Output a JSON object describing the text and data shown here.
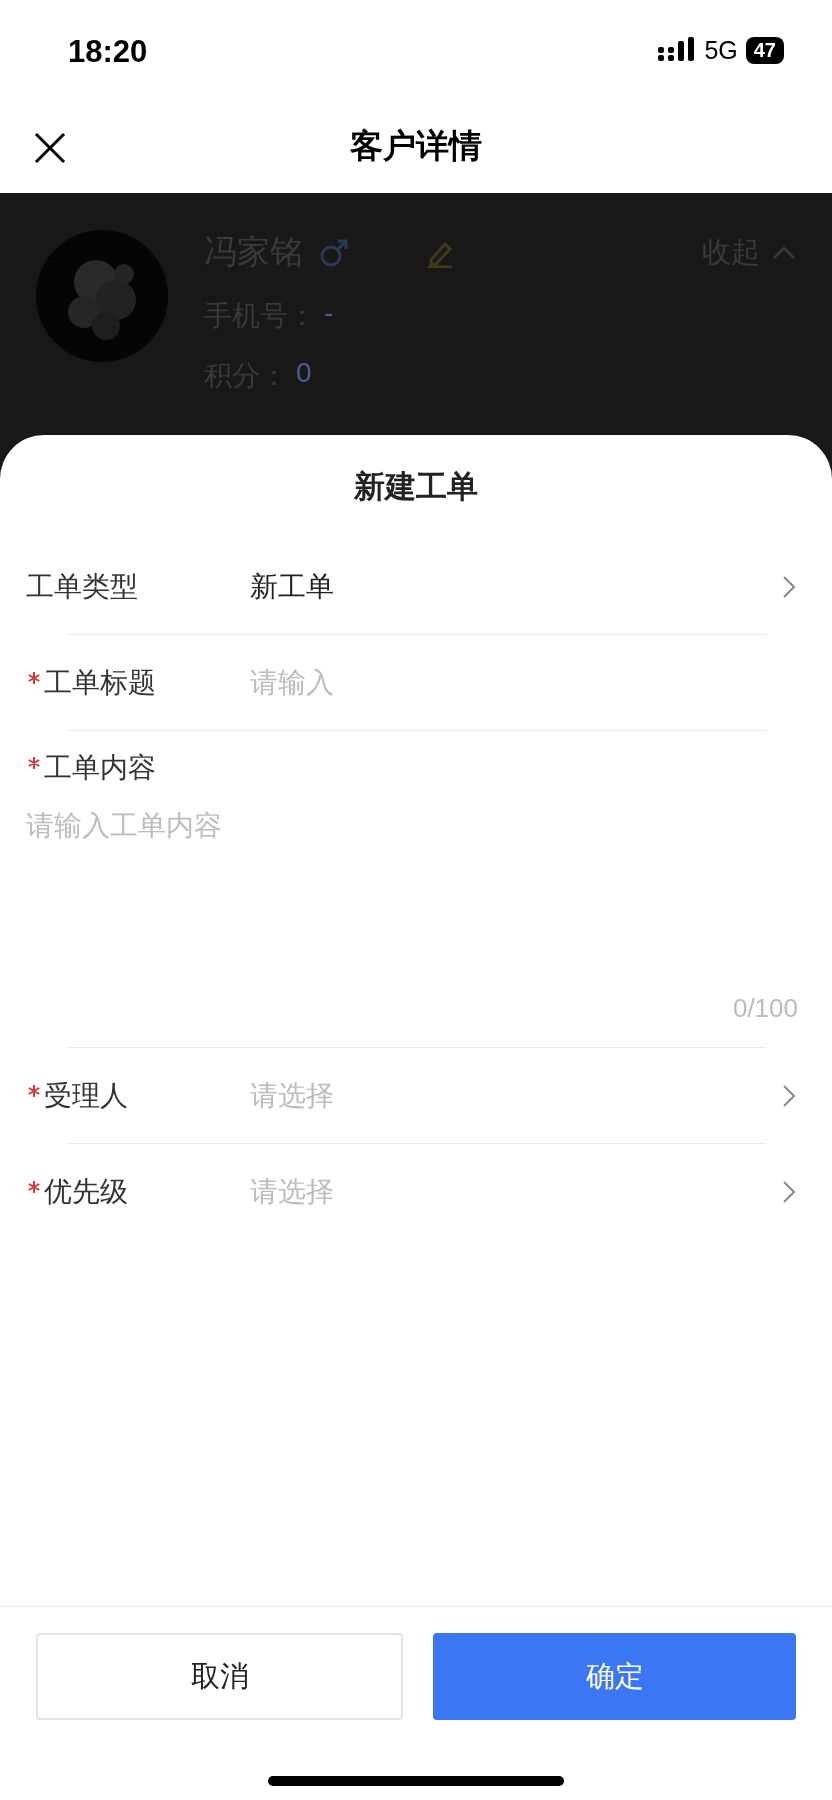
{
  "status_bar": {
    "time": "18:20",
    "network": "5G",
    "battery": "47"
  },
  "nav_bar": {
    "title": "客户详情"
  },
  "customer": {
    "name": "冯家铭",
    "collapse": "收起",
    "fields": [
      {
        "label": "手机号：",
        "value": "-"
      },
      {
        "label": "积分：",
        "value": "0"
      }
    ]
  },
  "sheet": {
    "title": "新建工单",
    "fields": [
      {
        "kind": "select",
        "label": "工单类型",
        "required": false,
        "value": "新工单"
      },
      {
        "kind": "text",
        "label": "工单标题",
        "required": true,
        "placeholder": "请输入"
      },
      {
        "kind": "textarea",
        "label": "工单内容",
        "required": true,
        "placeholder": "请输入工单内容",
        "counter": "0/100"
      },
      {
        "kind": "select",
        "label": "受理人",
        "required": true,
        "placeholder": "请选择"
      },
      {
        "kind": "select",
        "label": "优先级",
        "required": true,
        "placeholder": "请选择"
      }
    ],
    "buttons": [
      {
        "kind": "secondary",
        "label": "取消"
      },
      {
        "kind": "primary",
        "label": "确定"
      }
    ]
  }
}
